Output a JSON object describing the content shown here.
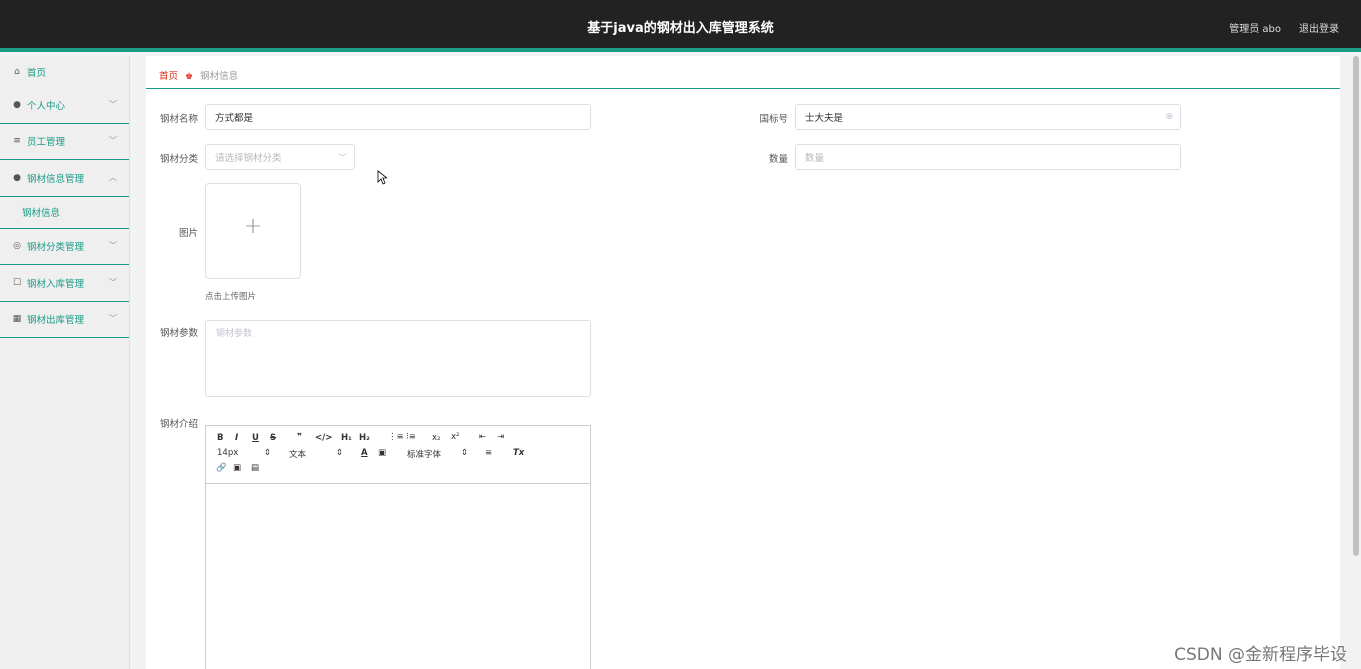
{
  "header": {
    "title": "基于java的钢材出入库管理系统",
    "user": "管理员 abo",
    "logout": "退出登录"
  },
  "sidebar": {
    "items": [
      {
        "label": "首页",
        "icon": "home-icon"
      },
      {
        "label": "个人中心",
        "icon": "user-icon"
      },
      {
        "label": "员工管理",
        "icon": "list-icon"
      },
      {
        "label": "钢材信息管理",
        "icon": "pin-icon"
      },
      {
        "label": "钢材信息",
        "icon": ""
      },
      {
        "label": "钢材分类管理",
        "icon": "target-icon"
      },
      {
        "label": "钢材入库管理",
        "icon": "inbox-icon"
      },
      {
        "label": "钢材出库管理",
        "icon": "grid-icon"
      }
    ]
  },
  "breadcrumb": {
    "home": "首页",
    "current": "钢材信息"
  },
  "form": {
    "name_label": "钢材名称",
    "name_value": "方式都是",
    "code_label": "国标号",
    "code_value": "士大夫是",
    "category_label": "钢材分类",
    "category_placeholder": "请选择钢材分类",
    "quantity_label": "数量",
    "quantity_placeholder": "数量",
    "image_label": "图片",
    "upload_tip": "点击上传图片",
    "params_label": "钢材参数",
    "params_placeholder": "钢材参数",
    "intro_label": "钢材介绍"
  },
  "editor": {
    "font_size": "14px",
    "text_type": "文本",
    "font_family": "标准字体"
  },
  "watermark": "CSDN @金新程序毕设",
  "colors": {
    "accent": "#1a9b86",
    "header_bg": "#222222",
    "breadcrumb_home": "#e0301e"
  }
}
